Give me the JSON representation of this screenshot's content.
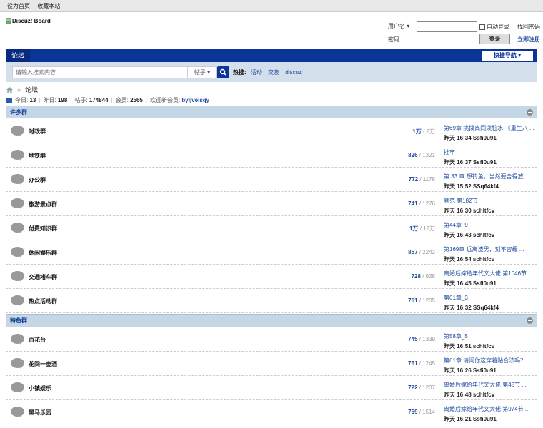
{
  "topbar": {
    "set_home": "设为首页",
    "bookmark": "收藏本站"
  },
  "logo": {
    "alt": "Discuz! Board"
  },
  "login": {
    "username_label": "用户名",
    "password_label": "密码",
    "auto_login": "自动登录",
    "login_button": "登录",
    "forgot": "找回密码",
    "register": "立即注册"
  },
  "nav": {
    "tab": "论坛",
    "quick_nav": "快捷导航"
  },
  "search": {
    "placeholder": "请输入搜索内容",
    "type": "帖子",
    "hot_label": "热搜:",
    "hot": [
      "活动",
      "交友",
      "discuz"
    ]
  },
  "breadcrumb": {
    "current": "论坛"
  },
  "stats": {
    "today_label": "今日:",
    "today": "13",
    "yesterday_label": "昨日:",
    "yesterday": "198",
    "posts_label": "帖子:",
    "posts": "174844",
    "members_label": "会员:",
    "members": "2565",
    "welcome_label": "欢迎新会员:",
    "new_member": "byljveisqy"
  },
  "categories": [
    {
      "name": "许多群",
      "forums": [
        {
          "name": "时政群",
          "threads": "1万",
          "posts": "2万",
          "last_title": "第69章 挑拨离间泼脏水-《重生八 ...",
          "last_meta": "昨天 16:34 Ssfi0u91"
        },
        {
          "name": "地铁群",
          "threads": "826",
          "posts": "1321",
          "last_title": "拴牢",
          "last_meta": "昨天 16:37 Ssfi0u91"
        },
        {
          "name": "办公群",
          "threads": "772",
          "posts": "1178",
          "last_title": "第 33 章 想钓鱼，当然要舍得放 ...",
          "last_meta": "昨天 15:52 SSq64kf4"
        },
        {
          "name": "旅游景点群",
          "threads": "741",
          "posts": "1276",
          "last_title": "就范 第182节",
          "last_meta": "昨天 16:30 schltfcv"
        },
        {
          "name": "付费知识群",
          "threads": "1万",
          "posts": "12万",
          "last_title": "第44章_9",
          "last_meta": "昨天 16:43 schltfcv"
        },
        {
          "name": "休闲娱乐群",
          "threads": "857",
          "posts": "2242",
          "last_title": "第169章 远离渣男，刻不容缓 ...",
          "last_meta": "昨天 16:54 schltfcv"
        },
        {
          "name": "交通堵车群",
          "threads": "728",
          "posts": "928",
          "last_title": "离婚后嫁给年代文大佬 第1046节 ...",
          "last_meta": "昨天 16:45 Ssfi0u91"
        },
        {
          "name": "热点活动群",
          "threads": "761",
          "posts": "1205",
          "last_title": "第61章_3",
          "last_meta": "昨天 16:32 SSq64kf4"
        }
      ]
    },
    {
      "name": "特色群",
      "forums": [
        {
          "name": "百花台",
          "threads": "745",
          "posts": "1339",
          "last_title": "第58章_5",
          "last_meta": "昨天 16:51 schltfcv"
        },
        {
          "name": "花间一壶酒",
          "threads": "761",
          "posts": "1245",
          "last_title": "第61章 请问你这穿着贴合法吗？ ...",
          "last_meta": "昨天 16:26 Ssfi0u91"
        },
        {
          "name": "小镇娱乐",
          "threads": "722",
          "posts": "1207",
          "last_title": "离婚后嫁给年代文大佬 第48节 ...",
          "last_meta": "昨天 16:48 schltfcv"
        },
        {
          "name": "黑马乐园",
          "threads": "759",
          "posts": "1514",
          "last_title": "离婚后嫁给年代文大佬 第974节 ...",
          "last_meta": "昨天 16:21 Ssfi0u91"
        }
      ]
    }
  ]
}
